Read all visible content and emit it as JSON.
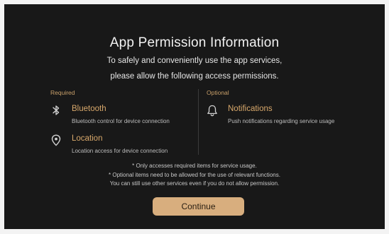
{
  "dialog": {
    "title": "App Permission Information",
    "subtitle_line1": "To safely and conveniently use the app services,",
    "subtitle_line2": "please allow the following access permissions."
  },
  "required": {
    "label": "Required",
    "items": [
      {
        "icon": "bluetooth-icon",
        "title": "Bluetooth",
        "description": "Bluetooth control for device connection"
      },
      {
        "icon": "location-pin-icon",
        "title": "Location",
        "description": "Location access for device connection"
      }
    ]
  },
  "optional": {
    "label": "Optional",
    "items": [
      {
        "icon": "bell-icon",
        "title": "Notifications",
        "description": "Push notifications regarding service usage"
      }
    ]
  },
  "notes": [
    "* Only accesses required items for service usage.",
    "* Optional items need to be allowed for the use of relevant functions.",
    "You can still use other services even if you do not allow permission."
  ],
  "continue_label": "Continue",
  "colors": {
    "background": "#181818",
    "accent": "#d8a86b",
    "button": "#d8ae7e"
  }
}
